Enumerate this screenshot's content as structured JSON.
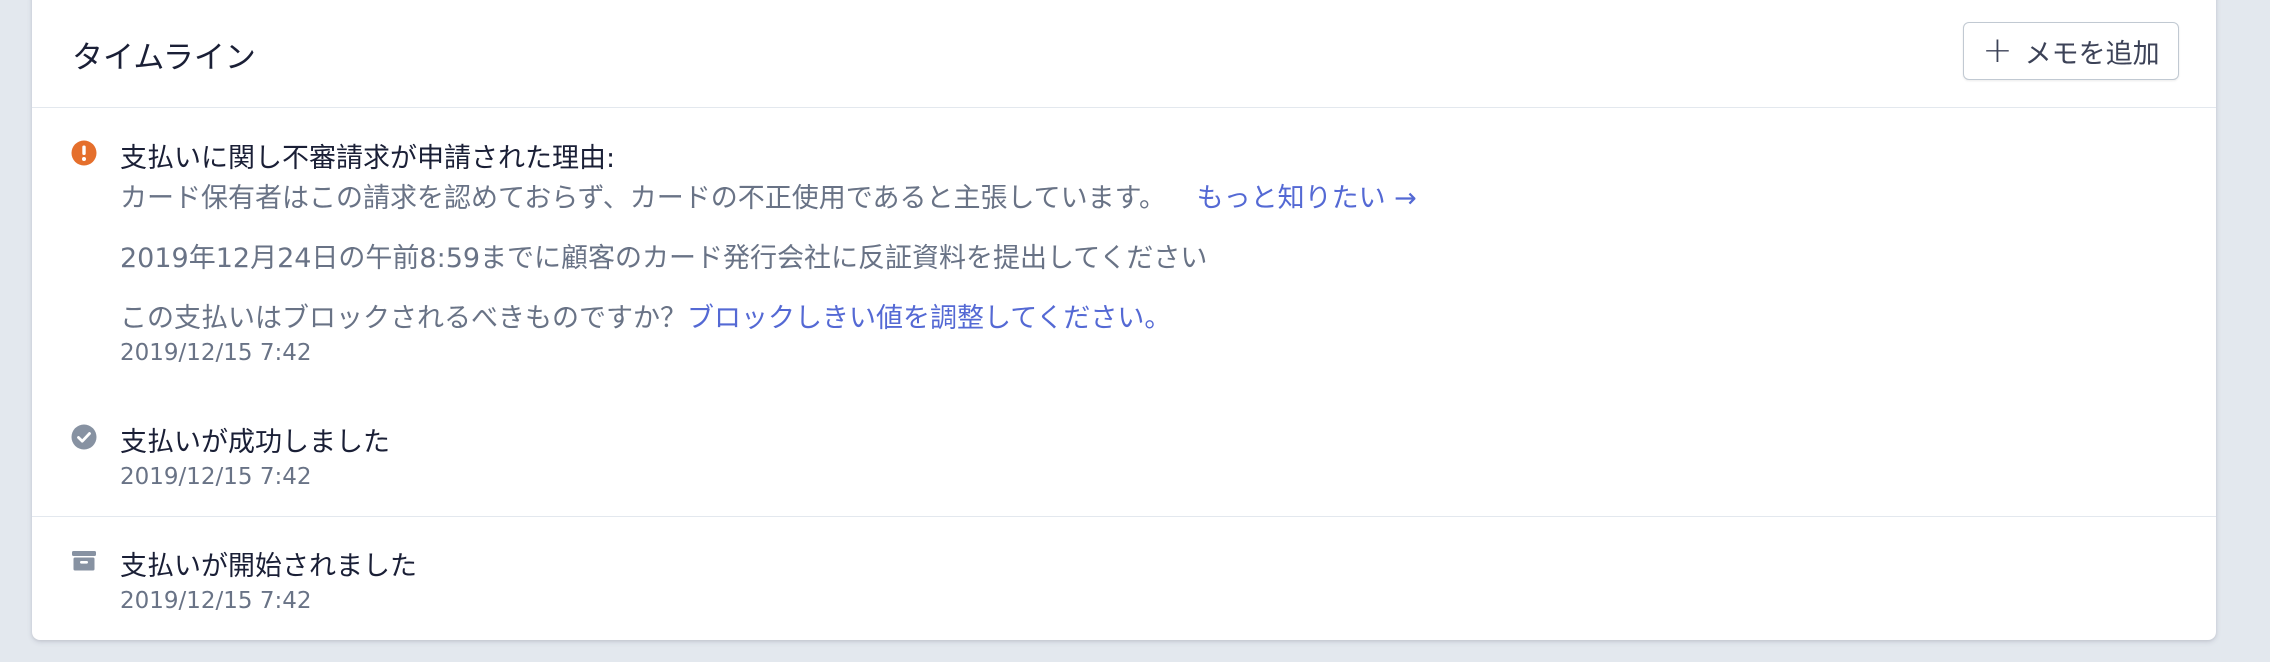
{
  "timeline": {
    "title": "タイムライン",
    "add_note_label": "メモを追加"
  },
  "events": [
    {
      "icon": "alert-icon",
      "title": "支払いに関し不審請求が申請された理由:",
      "reason": "カード保有者はこの請求を認めておらず、カードの不正使用であると主張しています。",
      "learn_more": "もっと知りたい →",
      "deadline": "2019年12月24日の午前8:59までに顧客のカード発行会社に反証資料を提出してください",
      "block_question": "この支払いはブロックされるべきものですか？",
      "block_link": "ブロックしきい値を調整してください。",
      "timestamp": "2019/12/15 7:42"
    },
    {
      "icon": "check-circle-icon",
      "title": "支払いが成功しました",
      "timestamp": "2019/12/15 7:42"
    },
    {
      "icon": "payment-started-icon",
      "title": "支払いが開始されました",
      "timestamp": "2019/12/15 7:42"
    }
  ],
  "colors": {
    "alert": "#e56f2c",
    "link": "#5469d4",
    "muted_icon": "#8792a2"
  }
}
